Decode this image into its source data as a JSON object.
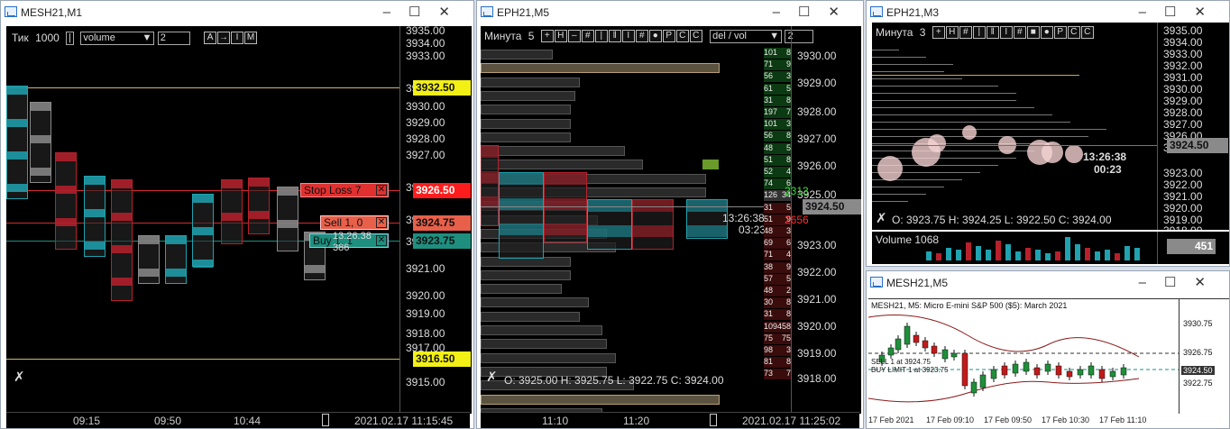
{
  "windows": {
    "w1": {
      "title": "MESH21,M1",
      "toolbar": {
        "mode_label": "Тик",
        "mode_value": "1000",
        "metric": "volume",
        "level": "2",
        "btn_a": "A"
      },
      "axis_ticks": [
        "3935.00",
        "3934.00",
        "3933.00",
        "3931.00",
        "3930.00",
        "3929.00",
        "3928.00",
        "3927.00",
        "3925.00",
        "3923.00",
        "3922.00",
        "3921.00",
        "3920.00",
        "3919.00",
        "3918.00",
        "3917.00",
        "3915.00"
      ],
      "price_tags": {
        "top": "3932.50",
        "stop": "3926.50",
        "sell": "3924.75",
        "buy": "3923.75",
        "bottom": "3916.50"
      },
      "orders": {
        "stop": "Stop Loss  7",
        "sell": "Sell  1,  0",
        "buy": "Buy  1,  1"
      },
      "timer": "13:26.38",
      "timer_sub": "386",
      "time_axis": [
        "09:15",
        "09:50",
        "10:44"
      ],
      "timestamp": "2021.02.17 11:15:45"
    },
    "w2": {
      "title": "EPH21,M5",
      "toolbar": {
        "mode_label": "Минута",
        "mode_value": "5",
        "metric": "del / vol",
        "level": "2"
      },
      "axis_ticks": [
        "3930.00",
        "3929.00",
        "3928.00",
        "3927.00",
        "3926.00",
        "3925.00",
        "3923.00",
        "3922.00",
        "3921.00",
        "3920.00",
        "3919.00",
        "3918.00"
      ],
      "price_tags": {
        "up": "2313",
        "last": "3924.50",
        "down": "2656"
      },
      "timer": "13:26:38",
      "timer_sub": "03:23",
      "ohlc": "O: 3925.00   H: 3925.75   L: 3922.75   C: 3924.00",
      "time_axis": [
        "11:10",
        "11:20"
      ],
      "timestamp": "2021.02.17 11:25:02",
      "dom_left": [
        "101",
        "71",
        "56",
        "61",
        "31",
        "197",
        "101",
        "56",
        "48",
        "51",
        "52",
        "74",
        "126",
        "31",
        "51",
        "48",
        "69",
        "71",
        "38",
        "57",
        "48",
        "30",
        "31",
        "109",
        "75",
        "98",
        "81",
        "73"
      ],
      "dom_right": [
        "8",
        "9",
        "3",
        "5",
        "8",
        "7",
        "3",
        "8",
        "5",
        "8",
        "4",
        "6",
        "34",
        "5",
        "9",
        "3",
        "6",
        "4",
        "9",
        "5",
        "2",
        "8",
        "8",
        "458",
        "75",
        "3",
        "8",
        "7"
      ]
    },
    "w3": {
      "title": "EPH21,M3",
      "toolbar": {
        "mode_label": "Минута",
        "mode_value": "3"
      },
      "axis_ticks": [
        "3935.00",
        "3934.00",
        "3933.00",
        "3932.00",
        "3931.00",
        "3930.00",
        "3929.00",
        "3928.00",
        "3927.00",
        "3926.00",
        "3925.00",
        "3923.00",
        "3922.00",
        "3921.00",
        "3920.00",
        "3919.00",
        "3918.00"
      ],
      "price_tag": "3924.50",
      "timer": "13:26:38",
      "timer_sub": "00:23",
      "ohlc": "O: 3923.75   H: 3924.25   L: 3922.50   C: 3924.00",
      "volume_label": "Volume 1068",
      "volume_value": "451"
    },
    "w4": {
      "title": "MESH21,M5",
      "header": "MESH21, M5:  Micro E-mini S&P 500 ($5): March 2021",
      "axis_ticks": [
        "3930.75",
        "3926.75",
        "3924.50",
        "3922.75"
      ],
      "sell_label": "SELL 1 at 3924.75",
      "buy_label": "BUY LIMIT 1 at 3923.75",
      "time_axis": [
        "17 Feb 2021",
        "17 Feb 09:10",
        "17 Feb 09:50",
        "17 Feb 10:30",
        "17 Feb 11:10"
      ]
    }
  },
  "colors": {
    "up": "#1fa3b0",
    "down": "#b8202b",
    "tag_yellow": "#f3f016",
    "tag_red": "#ff1c1c",
    "tag_green": "#1e8f7f",
    "tag_gray": "#8a8a8a"
  }
}
